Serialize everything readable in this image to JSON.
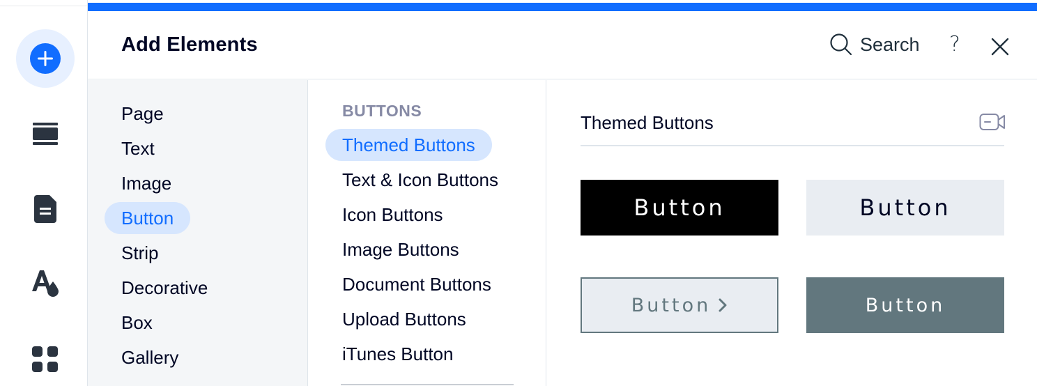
{
  "rail": {
    "items": [
      {
        "icon": "add-icon",
        "active": true
      },
      {
        "icon": "sections-icon",
        "active": false
      },
      {
        "icon": "pages-icon",
        "active": false
      },
      {
        "icon": "theme-icon",
        "active": false
      },
      {
        "icon": "apps-icon",
        "active": false
      }
    ]
  },
  "header": {
    "title": "Add Elements",
    "search_label": "Search",
    "help_label": "?"
  },
  "categories": [
    {
      "label": "Page",
      "active": false
    },
    {
      "label": "Text",
      "active": false
    },
    {
      "label": "Image",
      "active": false
    },
    {
      "label": "Button",
      "active": true
    },
    {
      "label": "Strip",
      "active": false
    },
    {
      "label": "Decorative",
      "active": false
    },
    {
      "label": "Box",
      "active": false
    },
    {
      "label": "Gallery",
      "active": false
    }
  ],
  "subcategories": {
    "heading": "BUTTONS",
    "items": [
      {
        "label": "Themed Buttons",
        "active": true
      },
      {
        "label": "Text & Icon Buttons",
        "active": false
      },
      {
        "label": "Icon Buttons",
        "active": false
      },
      {
        "label": "Image Buttons",
        "active": false
      },
      {
        "label": "Document Buttons",
        "active": false
      },
      {
        "label": "Upload Buttons",
        "active": false
      },
      {
        "label": "iTunes Button",
        "active": false
      }
    ]
  },
  "preview": {
    "section_title": "Themed Buttons",
    "video_icon": "video-icon",
    "buttons": [
      {
        "label": "Button",
        "style": "black"
      },
      {
        "label": "Button",
        "style": "light"
      },
      {
        "label": "Button",
        "style": "outline-arrow"
      },
      {
        "label": "Button",
        "style": "teal"
      }
    ]
  },
  "colors": {
    "accent": "#116dff",
    "accent_light": "#d6e6fe",
    "teal": "#62777e",
    "light_gray": "#e9edf2"
  }
}
